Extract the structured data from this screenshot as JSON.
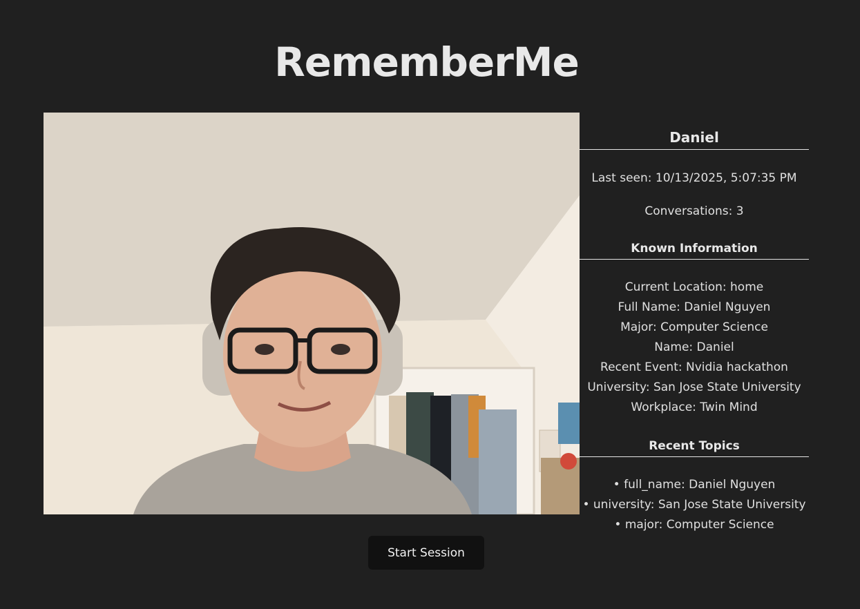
{
  "app": {
    "title": "RememberMe"
  },
  "person": {
    "name": "Daniel",
    "last_seen": "Last seen: 10/13/2025, 5:07:35 PM",
    "conversations": "Conversations: 3"
  },
  "known_information": {
    "heading": "Known Information",
    "items": [
      "Current Location: home",
      "Full Name: Daniel Nguyen",
      "Major: Computer Science",
      "Name: Daniel",
      "Recent Event: Nvidia hackathon",
      "University: San Jose State University",
      "Workplace: Twin Mind"
    ]
  },
  "recent_topics": {
    "heading": "Recent Topics",
    "items": [
      "• full_name: Daniel Nguyen",
      "• university: San Jose State University",
      "• major: Computer Science"
    ]
  },
  "controls": {
    "start_session_label": "Start Session"
  },
  "colors": {
    "background": "#202020",
    "button": "#111111",
    "text": "#e6e6e6"
  }
}
